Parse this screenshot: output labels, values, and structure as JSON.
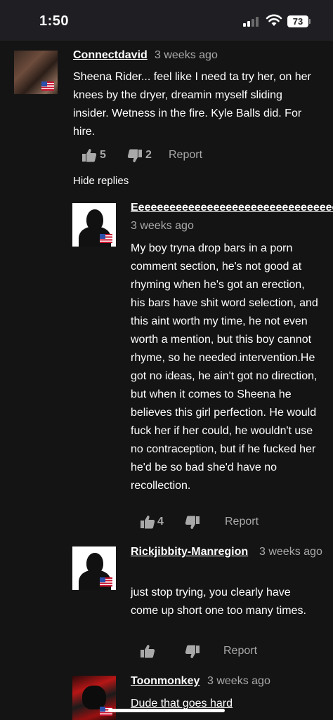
{
  "status_bar": {
    "time": "1:50",
    "battery": "73"
  },
  "comments": [
    {
      "author": "Connectdavid",
      "time": "3 weeks ago",
      "text": "Sheena Rider... feel like I need ta try her, on her knees by the dryer, dreamin myself sliding insider. Wetness in the fire. Kyle Balls did. For hire.",
      "likes": "5",
      "dislikes": "2",
      "report": "Report",
      "hide_replies": "Hide replies"
    }
  ],
  "replies": [
    {
      "author": "Eeeeeeeeeeeeeeeeeeeeeeeeeeeeeeeeee",
      "time": "3 weeks ago",
      "text": "My boy tryna drop bars in a porn comment section, he's not good at rhyming when he's got an erection, his bars have shit word selection, and this aint worth my time, he not even worth a mention, but this boy cannot rhyme, so he needed intervention.He got no ideas, he ain't got no direction, but when it comes to Sheena he believes this girl perfection. He would fuck her if her could, he wouldn't use no contraception, but if he fucked her he'd be so bad she'd have no recollection.",
      "likes": "4",
      "report": "Report"
    },
    {
      "author": "Rickjibbity-Manregion",
      "time": "3 weeks ago",
      "text": "just stop trying, you clearly have come up short one too many times.",
      "report": "Report"
    },
    {
      "author": "Toonmonkey",
      "time": "3 weeks ago",
      "text": "Dude that goes hard"
    }
  ]
}
